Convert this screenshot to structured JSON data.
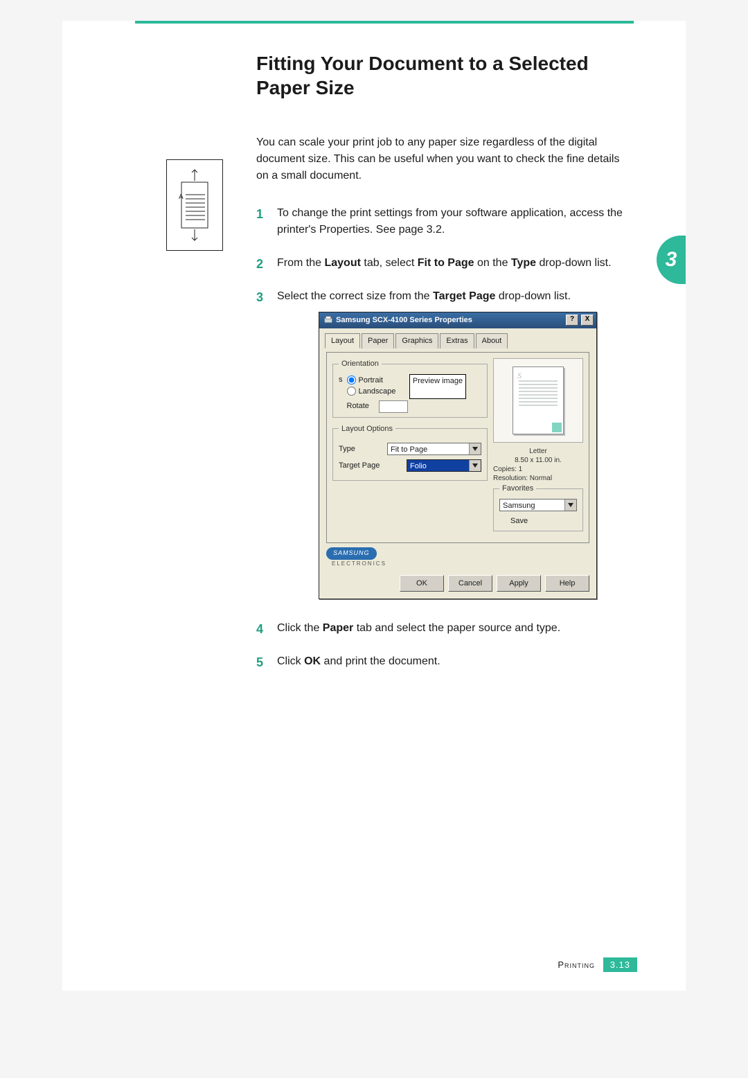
{
  "chapter_tab": "3",
  "heading": "Fitting Your Document to a Selected Paper Size",
  "intro": "You can scale your print job to any paper size regardless of the digital document size. This can be useful when you want to check the fine details on a small document.",
  "steps": {
    "s1": "To change the print settings from your software application, access the printer's Properties. See page 3.2.",
    "s2_a": "From the ",
    "s2_b": "Layout",
    "s2_c": " tab, select ",
    "s2_d": "Fit to Page",
    "s2_e": " on the ",
    "s2_f": "Type",
    "s2_g": " drop-down list.",
    "s3_a": "Select the correct size from the ",
    "s3_b": "Target Page",
    "s3_c": " drop-down list.",
    "s4_a": "Click the ",
    "s4_b": "Paper",
    "s4_c": " tab and select the paper source and type.",
    "s5_a": "Click ",
    "s5_b": "OK",
    "s5_c": " and print the document."
  },
  "side_illustration_label": "A",
  "dialog": {
    "title": "Samsung SCX-4100 Series Properties",
    "help_btn": "?",
    "close_btn": "X",
    "tabs": [
      "Layout",
      "Paper",
      "Graphics",
      "Extras",
      "About"
    ],
    "active_tab": "Layout",
    "orientation": {
      "legend": "Orientation",
      "portrait": "Portrait",
      "landscape": "Landscape",
      "rotate": "Rotate"
    },
    "layout_options": {
      "legend": "Layout Options",
      "type_label": "Type",
      "type_value": "Fit to Page",
      "target_label": "Target Page",
      "target_value": "Folio"
    },
    "callout": "Preview image",
    "preview_meta": {
      "size_name": "Letter",
      "dims": "8.50 x 11.00 in.",
      "copies": "Copies: 1",
      "resolution": "Resolution: Normal"
    },
    "favorites": {
      "legend": "Favorites",
      "value": "Samsung",
      "save": "Save"
    },
    "brand": "SAMSUNG",
    "brand_sub": "ELECTRONICS",
    "buttons": {
      "ok": "OK",
      "cancel": "Cancel",
      "apply": "Apply",
      "help": "Help"
    }
  },
  "footer": {
    "section": "Printing",
    "page": "3.13"
  }
}
